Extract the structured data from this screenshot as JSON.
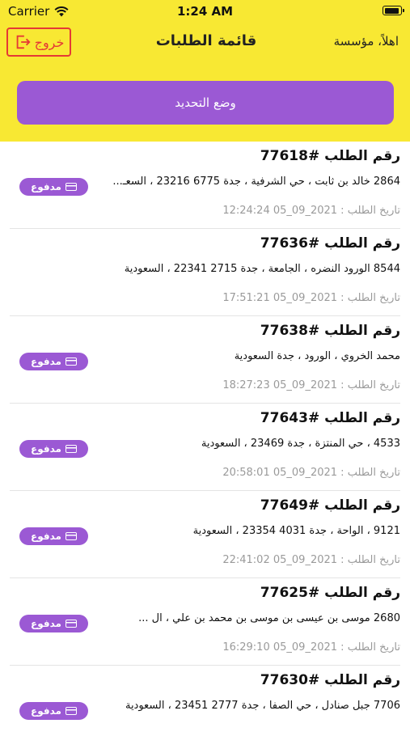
{
  "status_bar": {
    "carrier": "Carrier",
    "time": "1:24 AM"
  },
  "header": {
    "logout_label": "خروج",
    "title": "قائمة الطلبات",
    "greeting": "اهلاً، مؤسسة"
  },
  "update_button": {
    "label": "وضع التحديد"
  },
  "colors": {
    "header_bg": "#f8e833",
    "accent": "#9b59d4",
    "logout": "#e53935"
  },
  "orders": [
    {
      "number": "رقم الطلب #77618",
      "address": "2864 خالد بن ثابت ، حي الشرفية ، جدة 6775 23216 ، السعـ...",
      "date": "تاريخ الطلب : 2021_09_05 12:24:24",
      "status": "مدفوع"
    },
    {
      "number": "رقم الطلب #77636",
      "address": "8544 الورود النضره ، الجامعة ، جدة 2715 22341 ، السعودية",
      "date": "تاريخ الطلب : 2021_09_05 17:51:21",
      "status": ""
    },
    {
      "number": "رقم الطلب #77638",
      "address": "محمد الخروي ، الورود ، جدة السعودية",
      "date": "تاريخ الطلب : 2021_09_05 18:27:23",
      "status": "مدفوع"
    },
    {
      "number": "رقم الطلب #77643",
      "address": "4533 ، حي المنتزة ، جدة 23469 ، السعودية",
      "date": "تاريخ الطلب : 2021_09_05 20:58:01",
      "status": "مدفوع"
    },
    {
      "number": "رقم الطلب #77649",
      "address": "9121 ، الواحة ، جدة 4031 23354 ، السعودية",
      "date": "تاريخ الطلب : 2021_09_05 22:41:02",
      "status": "مدفوع"
    },
    {
      "number": "رقم الطلب #77625",
      "address": "2680 موسى بن عيسى بن موسى بن محمد بن علي ، ال ...",
      "date": "تاريخ الطلب : 2021_09_05 16:29:10",
      "status": "مدفوع"
    },
    {
      "number": "رقم الطلب #77630",
      "address": "7706 جبل صنادل ، حي الصفا ، جدة 2777 23451 ، السعودية",
      "date": "",
      "status": "مدفوع"
    }
  ]
}
